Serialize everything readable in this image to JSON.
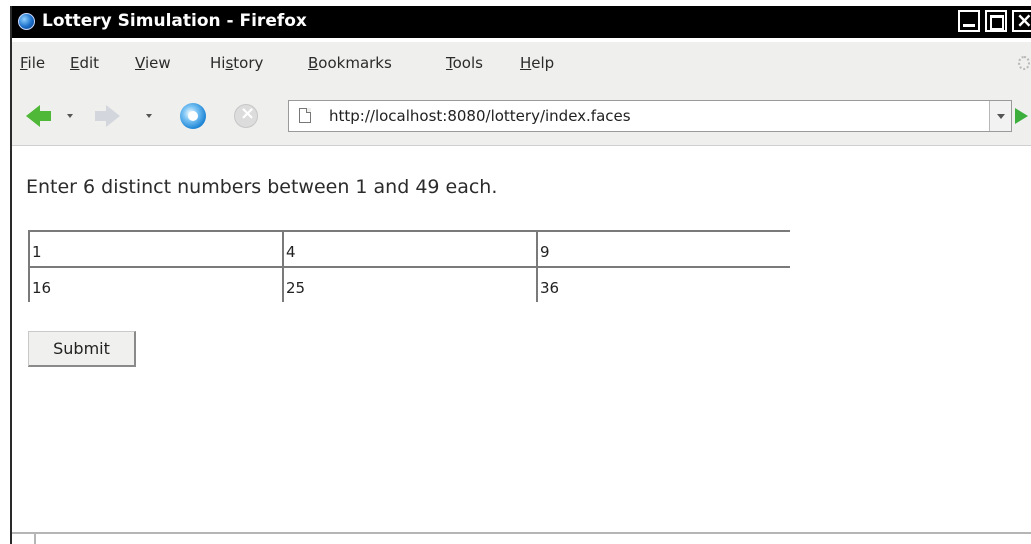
{
  "window": {
    "title": "Lottery Simulation - Firefox"
  },
  "menubar": {
    "items": [
      {
        "accel": "F",
        "rest": "ile"
      },
      {
        "accel": "E",
        "rest": "dit"
      },
      {
        "accel": "V",
        "rest": "iew"
      },
      {
        "pre": "Hi",
        "accel": "s",
        "rest": "tory"
      },
      {
        "accel": "B",
        "rest": "ookmarks"
      },
      {
        "accel": "T",
        "rest": "ools"
      },
      {
        "accel": "H",
        "rest": "elp"
      }
    ]
  },
  "navbar": {
    "url": "http://localhost:8080/lottery/index.faces"
  },
  "page": {
    "instructions": "Enter 6 distinct numbers between 1 and 49 each.",
    "numbers": [
      "1",
      "4",
      "9",
      "16",
      "25",
      "36"
    ],
    "submit_label": "Submit"
  },
  "icons": {
    "app": "firefox-globe-icon",
    "back": "back-arrow-icon",
    "forward": "forward-arrow-icon",
    "reload": "reload-icon",
    "stop": "stop-icon",
    "page": "page-icon",
    "go": "go-arrow-icon"
  },
  "colors": {
    "titlebar": "#000000",
    "toolbar": "#efefed",
    "back_arrow": "#4fb838",
    "go_arrow": "#3cae3c"
  }
}
